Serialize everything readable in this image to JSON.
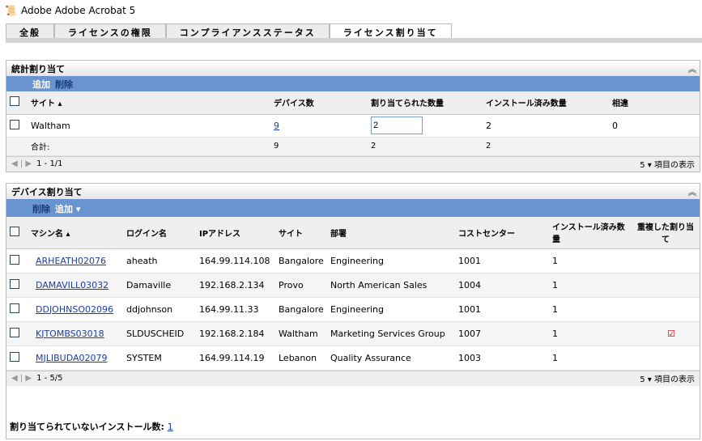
{
  "title": "Adobe Adobe Acrobat 5",
  "tabs": [
    "全般",
    "ライセンスの権限",
    "コンプライアンスステータス",
    "ライセンス割り当て"
  ],
  "stat": {
    "header": "統計割り当て",
    "add": "追加",
    "delete": "削除",
    "columns": [
      "サイト",
      "デバイス数",
      "割り当てられた数量",
      "インストール済み数量",
      "相違"
    ],
    "row": {
      "site": "Waltham",
      "devices": "9",
      "assigned": "2",
      "installed": "2",
      "diff": "0"
    },
    "total": {
      "label": "合計:",
      "devices": "9",
      "assigned": "2",
      "installed": "2"
    },
    "pager": "1 - 1/1",
    "per_page": "5 ▾ 項目の表示"
  },
  "device": {
    "header": "デバイス割り当て",
    "delete": "削除",
    "add": "追加 ▾",
    "columns": [
      "マシン名",
      "ログイン名",
      "IPアドレス",
      "サイト",
      "部署",
      "コストセンター",
      "インストール済み数量",
      "重複した割り当て"
    ],
    "rows": [
      {
        "machine": "ARHEATH02076",
        "login": "aheath",
        "ip": "164.99.114.108",
        "site": "Bangalore",
        "dept": "Engineering",
        "cost": "1001",
        "qty": "1",
        "dup": false
      },
      {
        "machine": "DAMAVILL03032",
        "login": "Damaville",
        "ip": "192.168.2.134",
        "site": "Provo",
        "dept": "North American Sales",
        "cost": "1004",
        "qty": "1",
        "dup": false
      },
      {
        "machine": "DDJOHNSO02096",
        "login": "ddjohnson",
        "ip": "164.99.11.33",
        "site": "Bangalore",
        "dept": "Engineering",
        "cost": "1001",
        "qty": "1",
        "dup": false
      },
      {
        "machine": "KJTOMBS03018",
        "login": "SLDUSCHEID",
        "ip": "192.168.2.184",
        "site": "Waltham",
        "dept": "Marketing Services Group",
        "cost": "1007",
        "qty": "1",
        "dup": true
      },
      {
        "machine": "MJLIBUDA02079",
        "login": "SYSTEM",
        "ip": "164.99.114.19",
        "site": "Lebanon",
        "dept": "Quality Assurance",
        "cost": "1003",
        "qty": "1",
        "dup": false
      }
    ],
    "pager": "1 - 5/5",
    "per_page": "5 ▾ 項目の表示"
  },
  "unassigned": {
    "label": "割り当てられていないインストール数:",
    "value": "1"
  }
}
